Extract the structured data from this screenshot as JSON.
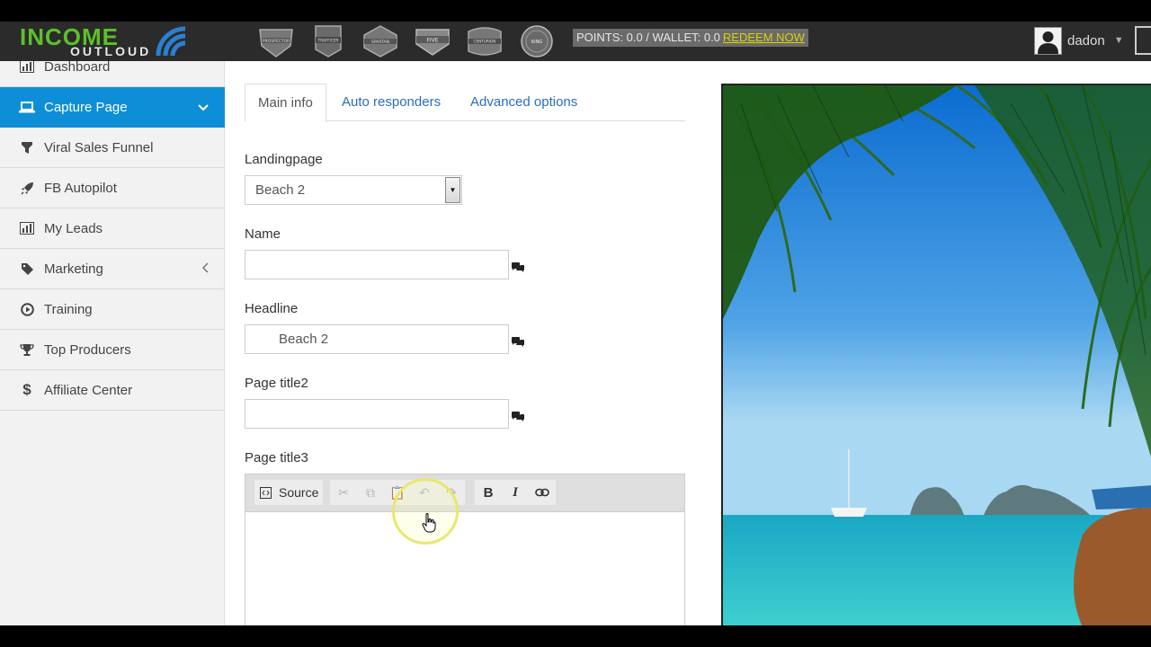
{
  "header": {
    "logo_top": "INCOME",
    "logo_bottom": "OUTLOUD",
    "badges": [
      "PROSPECTOR",
      "TRAFFICER",
      "SPARTAN",
      "FIVE",
      "CENTURION",
      "KING"
    ],
    "points_text": "POINTS: 0.0 / WALLET: 0.0",
    "redeem_label": "REDEEM NOW",
    "username": "dadon",
    "redeem_color": "#d9d200"
  },
  "sidebar": {
    "items": [
      {
        "label": "Dashboard",
        "icon": "bar-chart-icon"
      },
      {
        "label": "Capture Page",
        "icon": "laptop-icon",
        "active": true
      },
      {
        "label": "Viral Sales Funnel",
        "icon": "funnel-icon"
      },
      {
        "label": "FB Autopilot",
        "icon": "rocket-icon"
      },
      {
        "label": "My Leads",
        "icon": "bar-chart-icon"
      },
      {
        "label": "Marketing",
        "icon": "tag-icon"
      },
      {
        "label": "Training",
        "icon": "play-circle-icon"
      },
      {
        "label": "Top Producers",
        "icon": "trophy-icon"
      },
      {
        "label": "Affiliate Center",
        "icon": "dollar-icon"
      }
    ],
    "active_color": "#0f8ed8"
  },
  "tabs": [
    {
      "label": "Main info",
      "active": true
    },
    {
      "label": "Auto responders"
    },
    {
      "label": "Advanced options"
    }
  ],
  "form": {
    "landingpage_label": "Landingpage",
    "landingpage_value": "Beach 2",
    "name_label": "Name",
    "name_value": "",
    "headline_label": "Headline",
    "headline_value": "Beach 2",
    "page_title2_label": "Page title2",
    "page_title2_value": "",
    "page_title3_label": "Page title3"
  },
  "editor": {
    "source_label": "Source",
    "buttons": [
      "cut-icon",
      "copy-icon",
      "paste-icon",
      "undo-icon",
      "redo-icon",
      "bold-icon",
      "italic-icon",
      "link-icon"
    ],
    "bold_label": "B",
    "italic_label": "I"
  }
}
